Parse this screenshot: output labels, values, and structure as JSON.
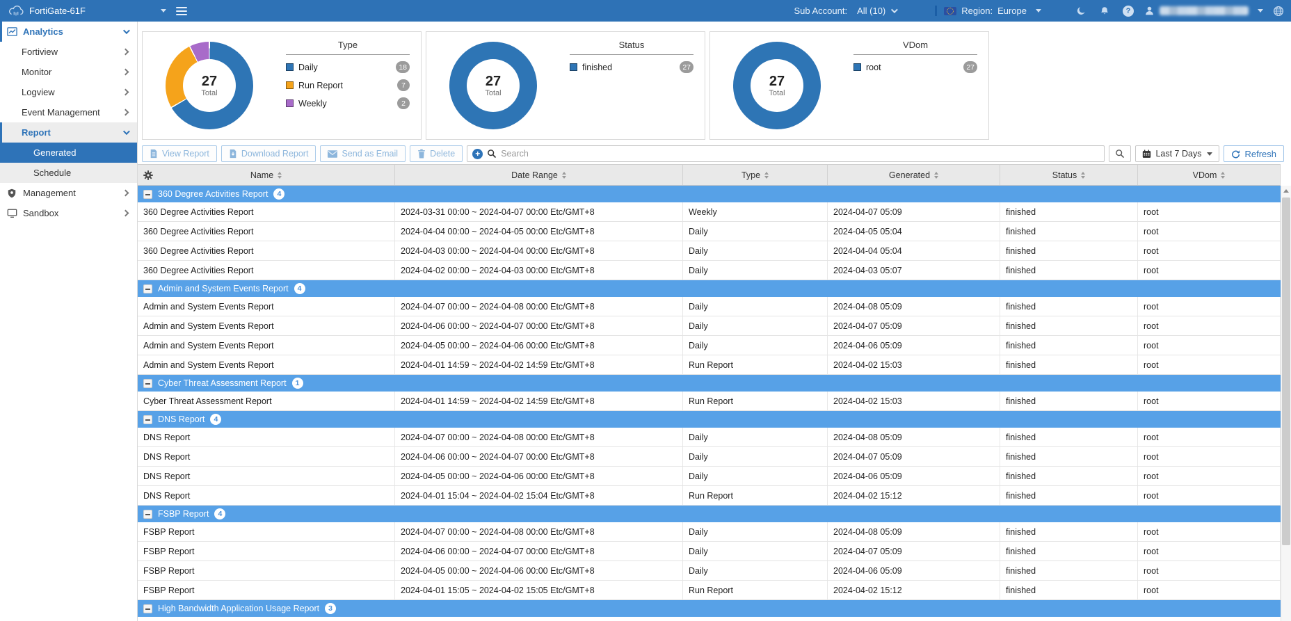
{
  "topbar": {
    "device": "FortiGate-61F",
    "sub_account_label": "Sub Account:",
    "sub_account_value": "All (10)",
    "region_label": "Region:",
    "region_value": "Europe",
    "icons": [
      "cloud-logo-icon",
      "menu-icon",
      "moon-icon",
      "bell-icon",
      "help-icon",
      "user-icon",
      "globe-icon",
      "europe-flag-icon"
    ]
  },
  "sidebar": {
    "items": [
      {
        "label": "Analytics",
        "icon": "line-chart-icon",
        "level": 1,
        "section": true,
        "chevron": "down"
      },
      {
        "label": "Fortiview",
        "level": 2,
        "chevron": "right"
      },
      {
        "label": "Monitor",
        "level": 2,
        "chevron": "right"
      },
      {
        "label": "Logview",
        "level": 2,
        "chevron": "right"
      },
      {
        "label": "Event Management",
        "level": 2,
        "chevron": "right"
      },
      {
        "label": "Report",
        "level": 2,
        "section": true,
        "gray": true,
        "chevron": "down"
      },
      {
        "label": "Generated",
        "level": 3,
        "selected": true
      },
      {
        "label": "Schedule",
        "level": 3,
        "gray": true
      },
      {
        "label": "Management",
        "icon": "shield-icon",
        "level": 1,
        "chevron": "right"
      },
      {
        "label": "Sandbox",
        "icon": "monitor-icon",
        "level": 1,
        "chevron": "right"
      }
    ]
  },
  "charts": [
    {
      "type": "donut",
      "title": "Type",
      "total": "27",
      "total_label": "Total",
      "segments": [
        {
          "label": "Daily",
          "value": 18,
          "color": "#2e75b5"
        },
        {
          "label": "Run Report",
          "value": 7,
          "color": "#f5a31b"
        },
        {
          "label": "Weekly",
          "value": 2,
          "color": "#a86bc9"
        }
      ]
    },
    {
      "type": "donut",
      "title": "Status",
      "total": "27",
      "total_label": "Total",
      "segments": [
        {
          "label": "finished",
          "value": 27,
          "color": "#2e75b5"
        }
      ]
    },
    {
      "type": "donut",
      "title": "VDom",
      "total": "27",
      "total_label": "Total",
      "segments": [
        {
          "label": "root",
          "value": 27,
          "color": "#2e75b5"
        }
      ]
    }
  ],
  "toolbar": {
    "buttons": [
      {
        "label": "View Report",
        "icon": "view-report-icon",
        "enabled": false
      },
      {
        "label": "Download Report",
        "icon": "download-report-icon",
        "enabled": false
      },
      {
        "label": "Send as Email",
        "icon": "email-icon",
        "enabled": false
      },
      {
        "label": "Delete",
        "icon": "delete-icon",
        "enabled": false
      }
    ],
    "search_placeholder": "Search",
    "range_label": "Last 7 Days",
    "refresh_label": "Refresh"
  },
  "table": {
    "columns": [
      "Name",
      "Date Range",
      "Type",
      "Generated",
      "Status",
      "VDom"
    ],
    "groups": [
      {
        "name": "360 Degree Activities Report",
        "count": 4,
        "rows": [
          [
            "360 Degree Activities Report",
            "2024-03-31 00:00 ~ 2024-04-07 00:00 Etc/GMT+8",
            "Weekly",
            "2024-04-07 05:09",
            "finished",
            "root"
          ],
          [
            "360 Degree Activities Report",
            "2024-04-04 00:00 ~ 2024-04-05 00:00 Etc/GMT+8",
            "Daily",
            "2024-04-05 05:04",
            "finished",
            "root"
          ],
          [
            "360 Degree Activities Report",
            "2024-04-03 00:00 ~ 2024-04-04 00:00 Etc/GMT+8",
            "Daily",
            "2024-04-04 05:04",
            "finished",
            "root"
          ],
          [
            "360 Degree Activities Report",
            "2024-04-02 00:00 ~ 2024-04-03 00:00 Etc/GMT+8",
            "Daily",
            "2024-04-03 05:07",
            "finished",
            "root"
          ]
        ]
      },
      {
        "name": "Admin and System Events Report",
        "count": 4,
        "rows": [
          [
            "Admin and System Events Report",
            "2024-04-07 00:00 ~ 2024-04-08 00:00 Etc/GMT+8",
            "Daily",
            "2024-04-08 05:09",
            "finished",
            "root"
          ],
          [
            "Admin and System Events Report",
            "2024-04-06 00:00 ~ 2024-04-07 00:00 Etc/GMT+8",
            "Daily",
            "2024-04-07 05:09",
            "finished",
            "root"
          ],
          [
            "Admin and System Events Report",
            "2024-04-05 00:00 ~ 2024-04-06 00:00 Etc/GMT+8",
            "Daily",
            "2024-04-06 05:09",
            "finished",
            "root"
          ],
          [
            "Admin and System Events Report",
            "2024-04-01 14:59 ~ 2024-04-02 14:59 Etc/GMT+8",
            "Run Report",
            "2024-04-02 15:03",
            "finished",
            "root"
          ]
        ]
      },
      {
        "name": "Cyber Threat Assessment Report",
        "count": 1,
        "rows": [
          [
            "Cyber Threat Assessment Report",
            "2024-04-01 14:59 ~ 2024-04-02 14:59 Etc/GMT+8",
            "Run Report",
            "2024-04-02 15:03",
            "finished",
            "root"
          ]
        ]
      },
      {
        "name": "DNS Report",
        "count": 4,
        "rows": [
          [
            "DNS Report",
            "2024-04-07 00:00 ~ 2024-04-08 00:00 Etc/GMT+8",
            "Daily",
            "2024-04-08 05:09",
            "finished",
            "root"
          ],
          [
            "DNS Report",
            "2024-04-06 00:00 ~ 2024-04-07 00:00 Etc/GMT+8",
            "Daily",
            "2024-04-07 05:09",
            "finished",
            "root"
          ],
          [
            "DNS Report",
            "2024-04-05 00:00 ~ 2024-04-06 00:00 Etc/GMT+8",
            "Daily",
            "2024-04-06 05:09",
            "finished",
            "root"
          ],
          [
            "DNS Report",
            "2024-04-01 15:04 ~ 2024-04-02 15:04 Etc/GMT+8",
            "Run Report",
            "2024-04-02 15:12",
            "finished",
            "root"
          ]
        ]
      },
      {
        "name": "FSBP Report",
        "count": 4,
        "rows": [
          [
            "FSBP Report",
            "2024-04-07 00:00 ~ 2024-04-08 00:00 Etc/GMT+8",
            "Daily",
            "2024-04-08 05:09",
            "finished",
            "root"
          ],
          [
            "FSBP Report",
            "2024-04-06 00:00 ~ 2024-04-07 00:00 Etc/GMT+8",
            "Daily",
            "2024-04-07 05:09",
            "finished",
            "root"
          ],
          [
            "FSBP Report",
            "2024-04-05 00:00 ~ 2024-04-06 00:00 Etc/GMT+8",
            "Daily",
            "2024-04-06 05:09",
            "finished",
            "root"
          ],
          [
            "FSBP Report",
            "2024-04-01 15:05 ~ 2024-04-02 15:05 Etc/GMT+8",
            "Run Report",
            "2024-04-02 15:12",
            "finished",
            "root"
          ]
        ]
      },
      {
        "name": "High Bandwidth Application Usage Report",
        "count": 3,
        "rows": []
      }
    ]
  }
}
